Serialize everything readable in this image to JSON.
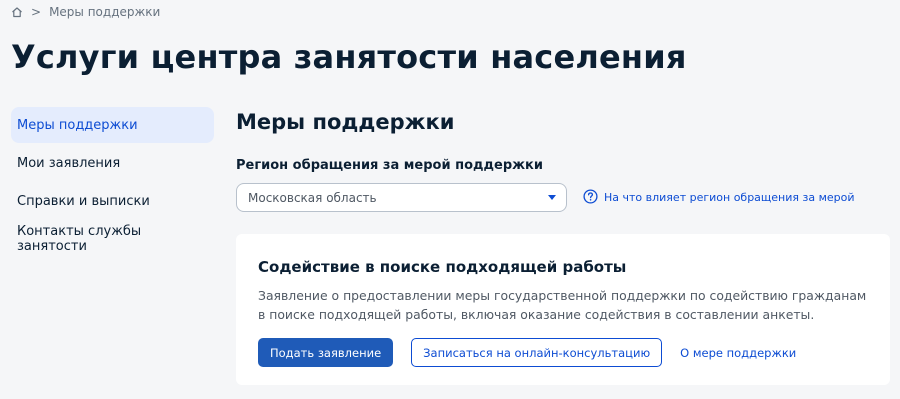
{
  "breadcrumb": {
    "separator": ">",
    "current": "Меры поддержки"
  },
  "page_title": "Услуги центра занятости населения",
  "sidebar": {
    "items": [
      {
        "label": "Меры поддержки"
      },
      {
        "label": "Мои заявления"
      },
      {
        "label": "Справки и выписки"
      },
      {
        "label": "Контакты службы занятости"
      }
    ]
  },
  "main": {
    "title": "Меры поддержки",
    "region_label": "Регион обращения за мерой поддержки",
    "region_value": "Московская область",
    "region_help": "На что влияет регион обращения за мерой"
  },
  "card": {
    "title": "Содействие в поиске подходящей работы",
    "description": "Заявление о предоставлении меры государственной поддержки по содействию гражданам в поиске подходящей работы, включая оказание содействия в составлении анкеты.",
    "apply_label": "Подать заявление",
    "consult_label": "Записаться на онлайн-консультацию",
    "about_label": "О мере поддержки"
  },
  "colors": {
    "accent": "#0d4cd3",
    "primary_button": "#1f5bb8",
    "active_item_bg": "#e4ecfd",
    "page_bg": "#f5f6f8"
  },
  "icons": [
    "home-icon",
    "chevron-down-icon",
    "help-circle-icon"
  ]
}
